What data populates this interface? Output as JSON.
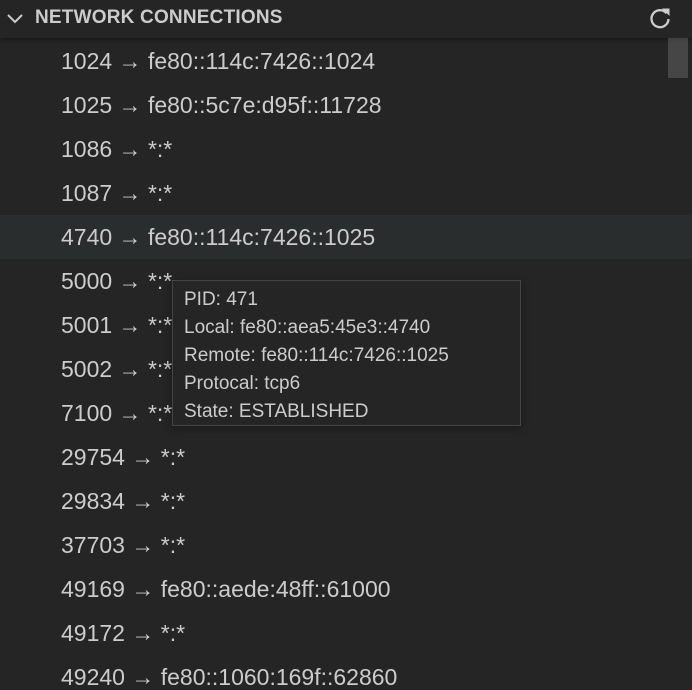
{
  "header": {
    "title": "NETWORK CONNECTIONS",
    "collapse_icon": "chevron-down-icon",
    "refresh_icon": "refresh-icon"
  },
  "connections": [
    {
      "label": "1024 → fe80::114c:7426::1024"
    },
    {
      "label": "1025 → fe80::5c7e:d95f::11728"
    },
    {
      "label": "1086 → *:*"
    },
    {
      "label": "1087 → *:*"
    },
    {
      "label": "4740 → fe80::114c:7426::1025"
    },
    {
      "label": "5000 → *:*"
    },
    {
      "label": "5001 → *:*"
    },
    {
      "label": "5002 → *:*"
    },
    {
      "label": "7100 → *:*"
    },
    {
      "label": "29754 → *:*"
    },
    {
      "label": "29834 → *:*"
    },
    {
      "label": "37703 → *:*"
    },
    {
      "label": "49169 → fe80::aede:48ff::61000"
    },
    {
      "label": "49172 → *:*"
    },
    {
      "label": "49240 → fe80::1060:169f::62860"
    }
  ],
  "hovered_row": 4,
  "tooltip": {
    "pid": "PID: 471",
    "local": "Local: fe80::aea5:45e3::4740",
    "remote": "Remote: fe80::114c:7426::1025",
    "protocol": "Protocal: tcp6",
    "state": "State: ESTABLISHED"
  },
  "colors": {
    "background": "#252526",
    "text": "#cccccc",
    "hover_row": "#2a2d2e",
    "tooltip_border": "#454545"
  }
}
